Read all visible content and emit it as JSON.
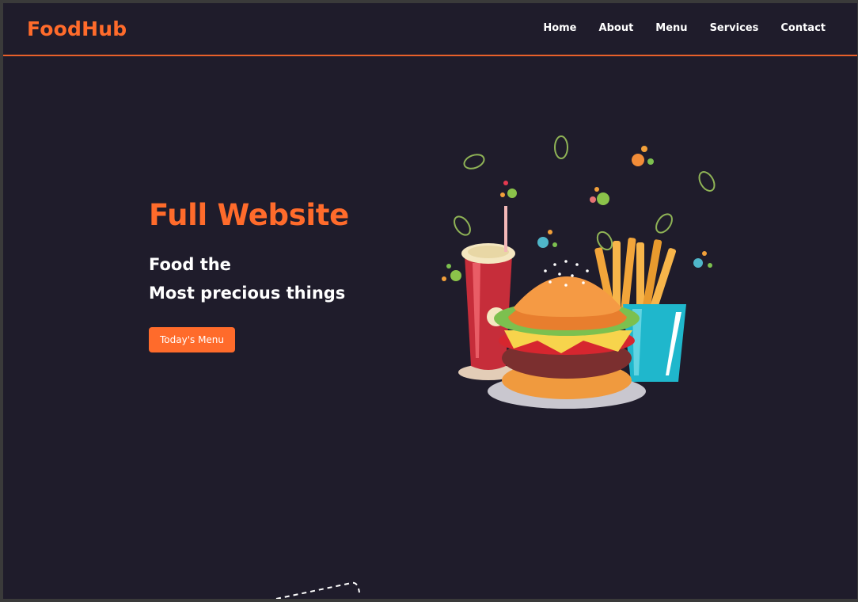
{
  "brand": {
    "name": "FoodHub",
    "accent": "#ff6b2b",
    "background": "#1f1c2b"
  },
  "nav": {
    "items": [
      {
        "label": "Home"
      },
      {
        "label": "About"
      },
      {
        "label": "Menu"
      },
      {
        "label": "Services"
      },
      {
        "label": "Contact"
      }
    ]
  },
  "hero": {
    "title": "Full Website",
    "subtitle_line1": "Food the",
    "subtitle_line2": "Most precious things",
    "button_label": "Today's Menu",
    "illustration": "burger-fries-soda-illustration"
  }
}
